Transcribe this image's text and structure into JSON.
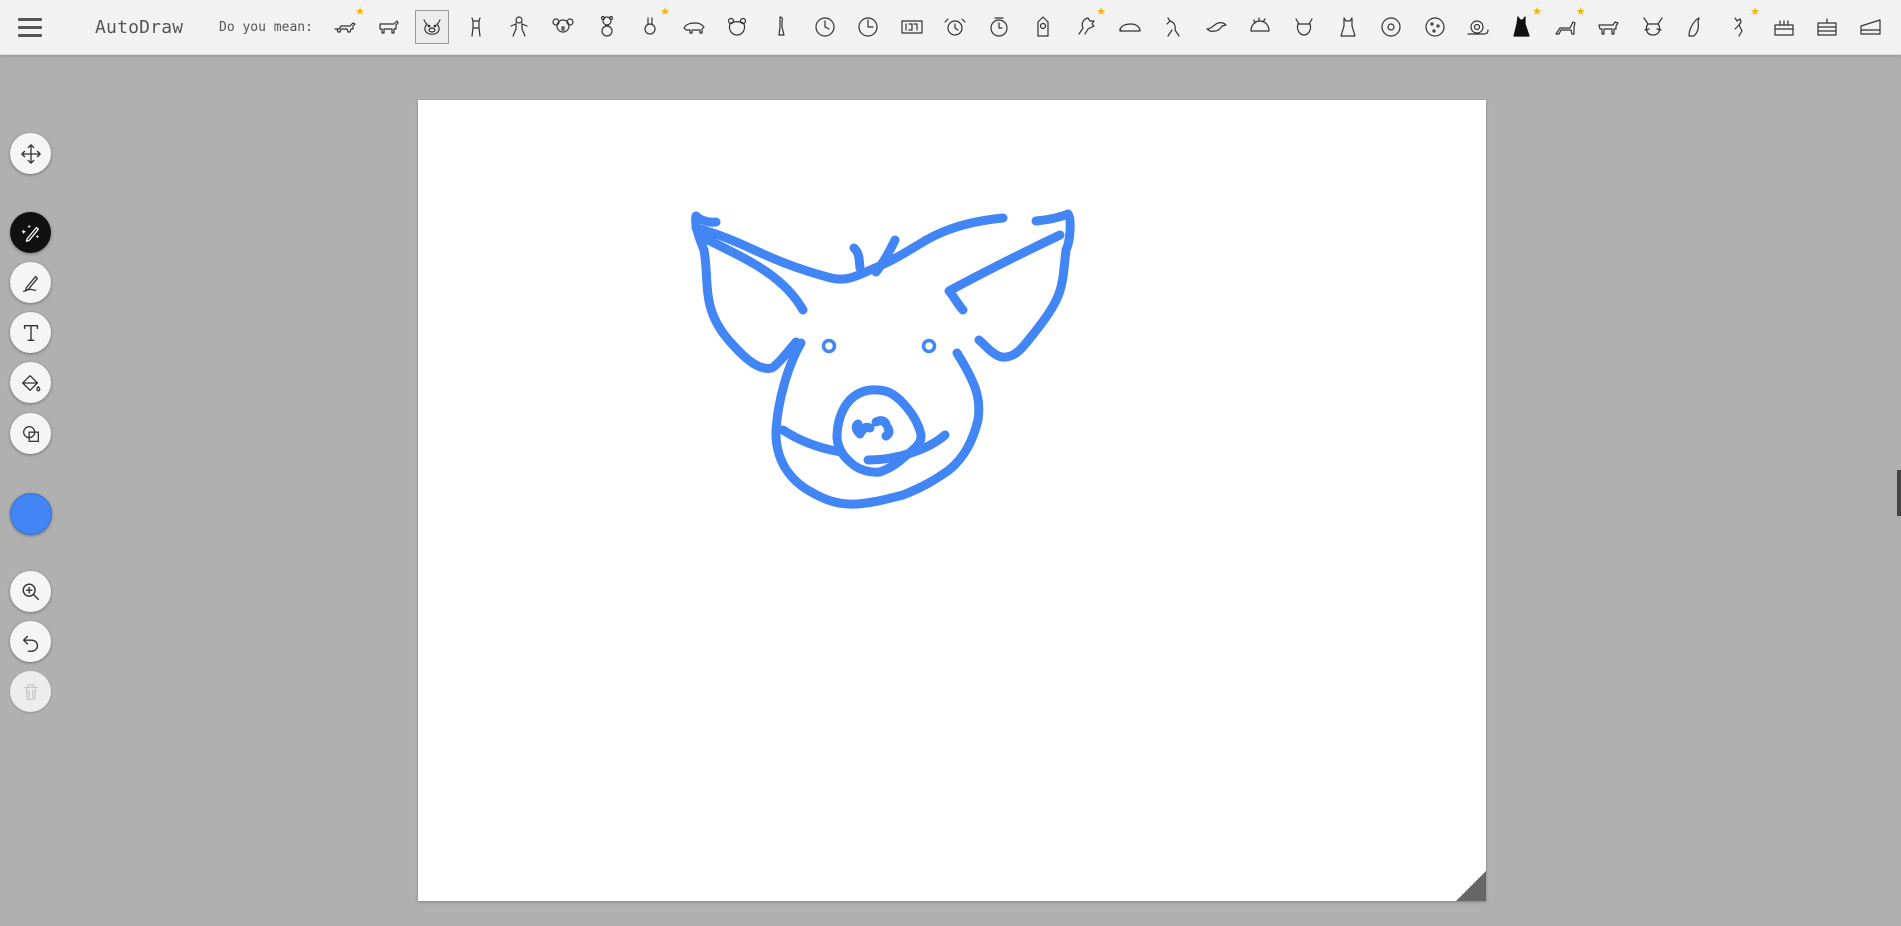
{
  "app": {
    "title": "AutoDraw",
    "suggest_label": "Do you mean:"
  },
  "suggestions": [
    {
      "icon": "dachshund-icon",
      "starred": true
    },
    {
      "icon": "dog-side-icon",
      "starred": false
    },
    {
      "icon": "pig-face-icon",
      "starred": false,
      "selected": true
    },
    {
      "icon": "standing-animal-icon",
      "starred": false
    },
    {
      "icon": "gingerbread-icon",
      "starred": false
    },
    {
      "icon": "koala-icon",
      "starred": false
    },
    {
      "icon": "teddy-bear-icon",
      "starred": false
    },
    {
      "icon": "bunny-face-icon",
      "starred": true
    },
    {
      "icon": "polar-bear-icon",
      "starred": false
    },
    {
      "icon": "bear-face-icon",
      "starred": false
    },
    {
      "icon": "meerkat-icon",
      "starred": false
    },
    {
      "icon": "wall-clock-icon",
      "starred": false
    },
    {
      "icon": "clock-icon",
      "starred": false
    },
    {
      "icon": "digital-clock-icon",
      "starred": false
    },
    {
      "icon": "alarm-clock-icon",
      "starred": false
    },
    {
      "icon": "round-alarm-clock-icon",
      "starred": false
    },
    {
      "icon": "clock-tower-icon",
      "starred": false
    },
    {
      "icon": "rooster-icon",
      "starred": true
    },
    {
      "icon": "sleeping-cat-icon",
      "starred": false
    },
    {
      "icon": "kangaroo-icon",
      "starred": false
    },
    {
      "icon": "bird-icon",
      "starred": false
    },
    {
      "icon": "hedgehog-icon",
      "starred": false
    },
    {
      "icon": "cat-face-icon",
      "starred": false
    },
    {
      "icon": "sitting-cat-icon",
      "starred": false
    },
    {
      "icon": "donut-icon",
      "starred": false
    },
    {
      "icon": "cookie-icon",
      "starred": false
    },
    {
      "icon": "snail-icon",
      "starred": false
    },
    {
      "icon": "black-cat-icon",
      "starred": true
    },
    {
      "icon": "cat-stretch-icon",
      "starred": true
    },
    {
      "icon": "walking-cat-icon",
      "starred": false
    },
    {
      "icon": "cat-head-icon",
      "starred": false
    },
    {
      "icon": "seal-icon",
      "starred": false
    },
    {
      "icon": "dancing-cat-icon",
      "starred": true
    },
    {
      "icon": "cake-icon",
      "starred": false
    },
    {
      "icon": "layer-cake-icon",
      "starred": false
    },
    {
      "icon": "cake-slice-icon",
      "starred": false
    }
  ],
  "tools": {
    "move": "move-tool",
    "autodraw": "autodraw-tool",
    "draw": "draw-tool",
    "type": "type-tool",
    "fill": "fill-tool",
    "shape": "shape-tool",
    "zoom": "zoom-tool",
    "undo": "undo-tool",
    "delete": "delete-tool"
  },
  "colors": {
    "selected_color": "#4285f4",
    "stroke": "#4285f4",
    "star": "#f5b400"
  }
}
